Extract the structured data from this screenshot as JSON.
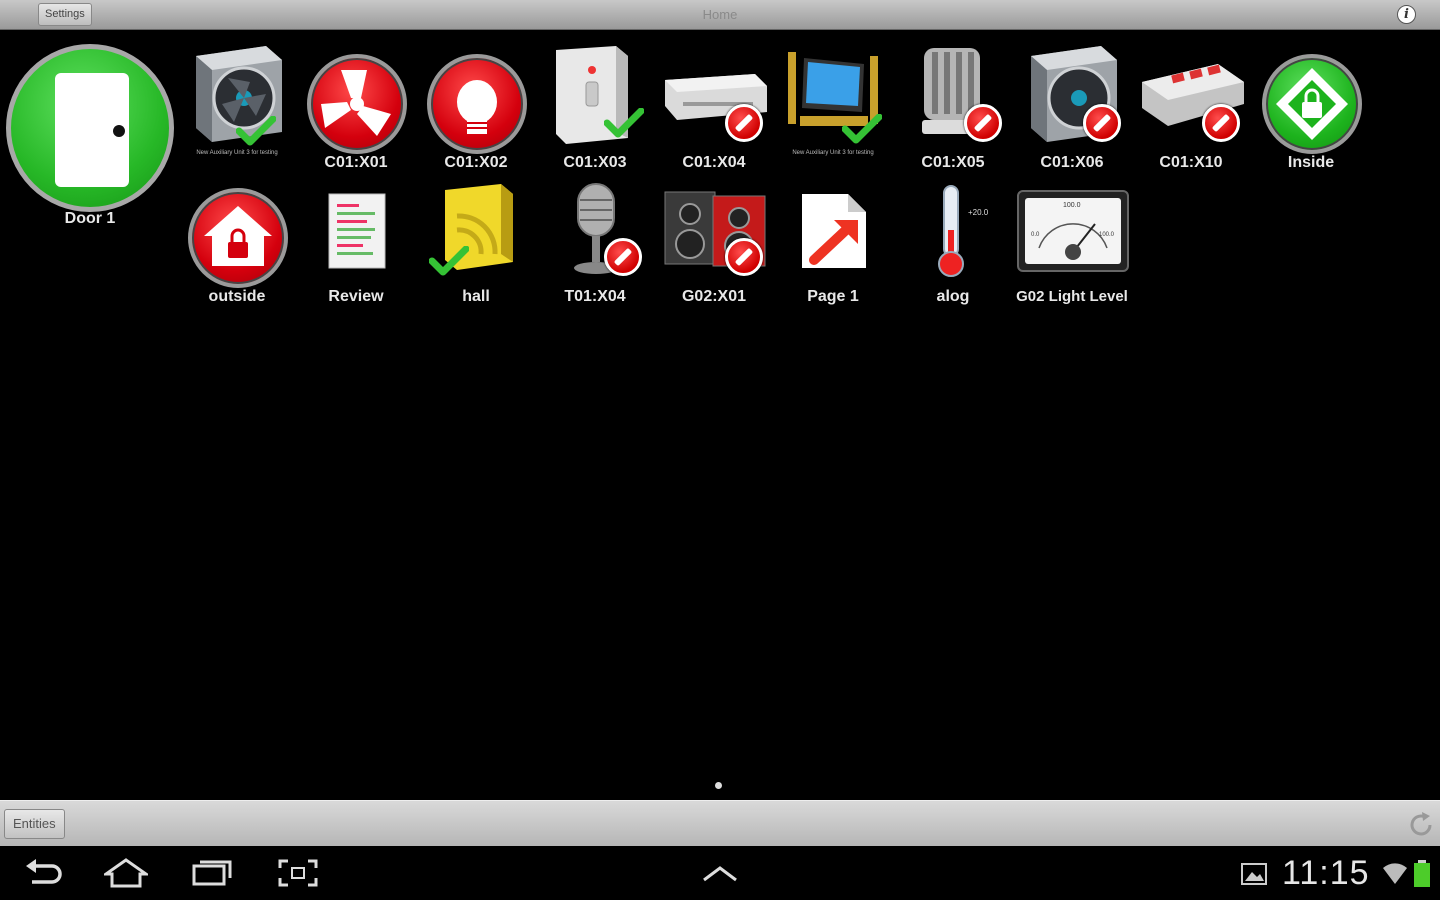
{
  "topbar": {
    "settings_label": "Settings",
    "title": "Home"
  },
  "tiles": {
    "door1": "Door 1",
    "t1_small": "New Auxiliary Unit 3 for testing",
    "c01x01": "C01:X01",
    "c01x02": "C01:X02",
    "c01x03": "C01:X03",
    "c01x04": "C01:X04",
    "t7_small": "New Auxiliary Unit 3 for testing",
    "c01x05": "C01:X05",
    "c01x06": "C01:X06",
    "c01x10": "C01:X10",
    "inside": "Inside",
    "outside": "outside",
    "review": "Review",
    "hall": "hall",
    "t01x04": "T01:X04",
    "g02x01": "G02:X01",
    "page1": "Page 1",
    "alog": "alog",
    "alog_value": "+20.0",
    "light": "G02 Light Level",
    "gauge_value": "100.0",
    "gauge_min": "0.0",
    "gauge_max": "100.0"
  },
  "bottombar": {
    "entities_label": "Entities"
  },
  "status": {
    "time": "11:15"
  },
  "colors": {
    "red": "#d4000d",
    "green": "#1db31d",
    "bar": "#bdbdbd"
  }
}
